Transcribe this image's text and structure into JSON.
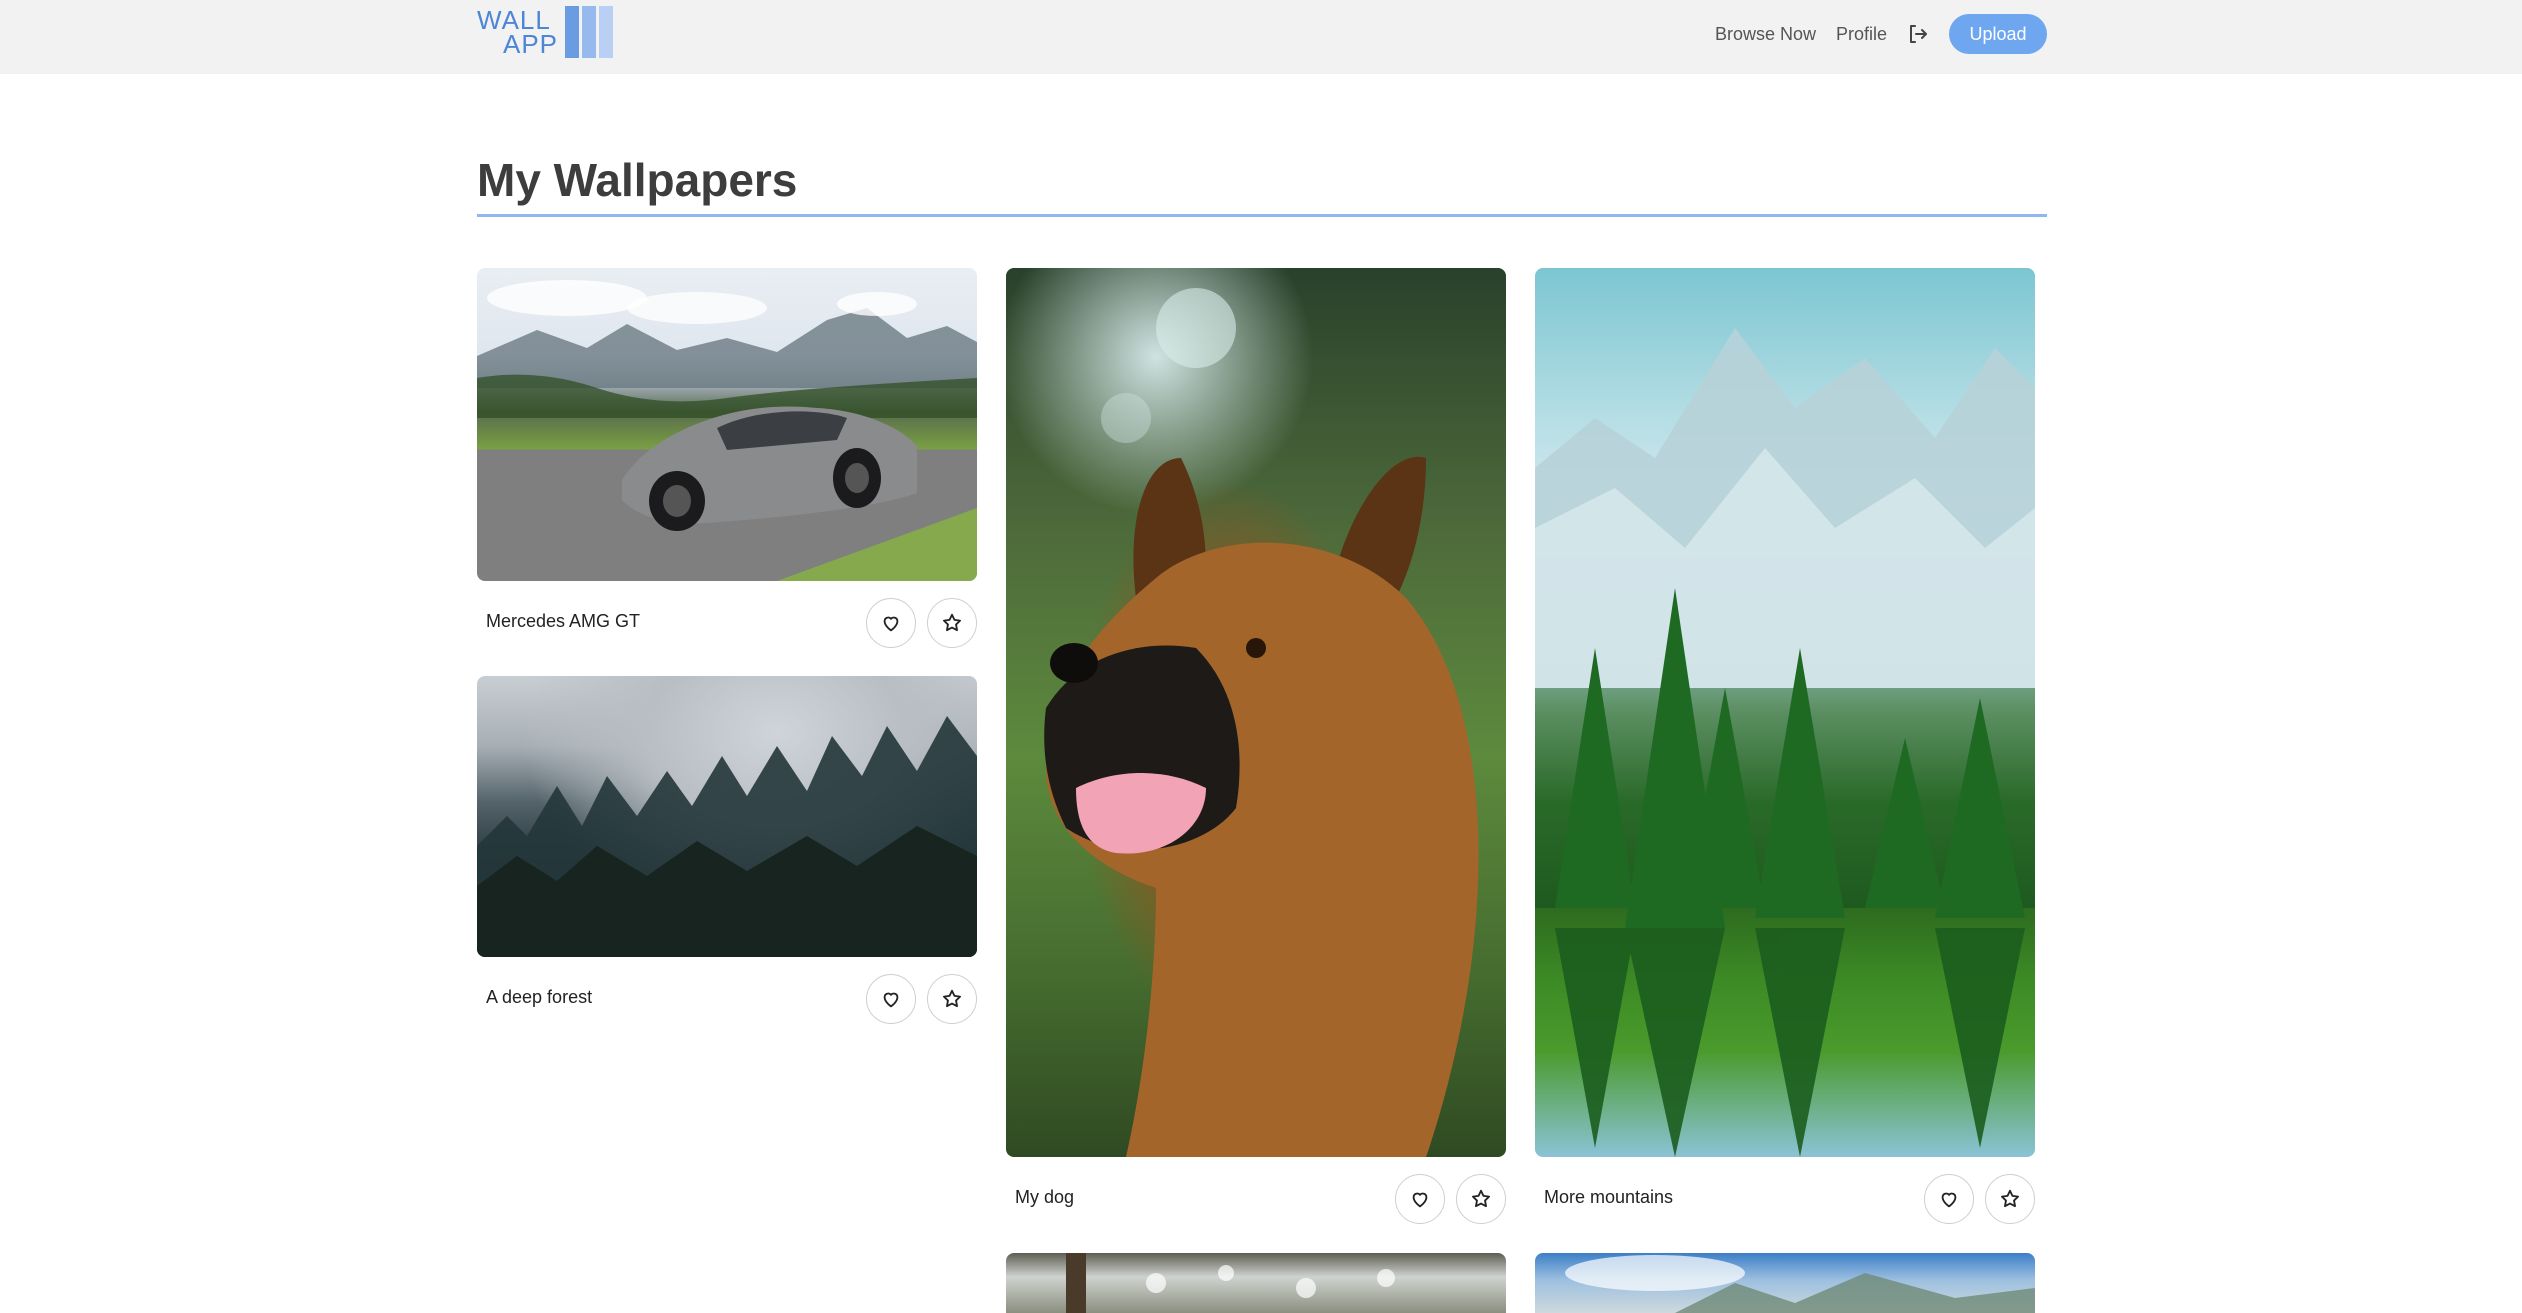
{
  "header": {
    "logo": {
      "line1": "WALL",
      "line2": "APP"
    },
    "nav": {
      "browse_label": "Browse Now",
      "profile_label": "Profile",
      "logout_icon": "logout-icon",
      "upload_label": "Upload"
    }
  },
  "main": {
    "title": "My Wallpapers",
    "wallpapers": [
      {
        "caption": "Mercedes AMG GT",
        "image": "car"
      },
      {
        "caption": "A deep forest",
        "image": "forest"
      },
      {
        "caption": "My dog",
        "image": "dog"
      },
      {
        "caption": "More mountains",
        "image": "mountains"
      },
      {
        "caption": "",
        "image": "flowers"
      },
      {
        "caption": "",
        "image": "lake"
      }
    ],
    "actions": {
      "like_icon": "heart-icon",
      "favorite_icon": "star-icon"
    }
  },
  "colors": {
    "accent": "#6ea7ef",
    "logo": "#4d86d6",
    "header_bg": "#f2f2f2",
    "rule": "#8fb8ee"
  }
}
